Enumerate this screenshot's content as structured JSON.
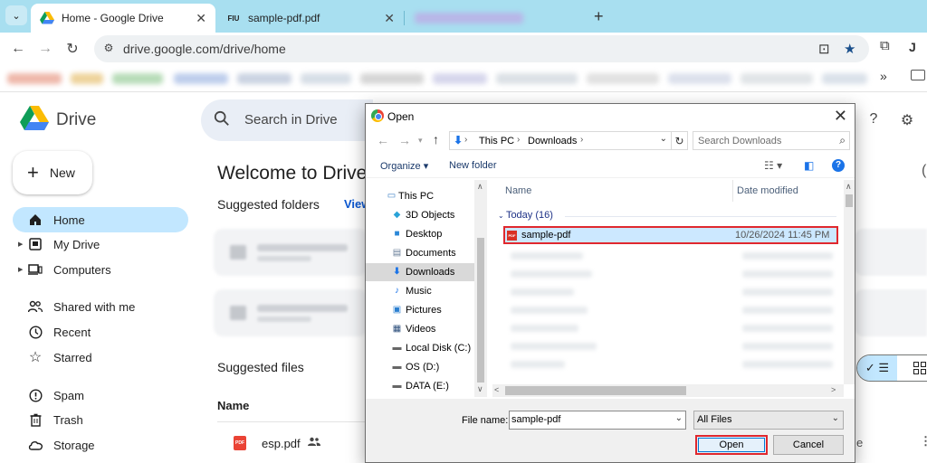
{
  "browser": {
    "tabs": [
      {
        "title": "Home - Google Drive",
        "favicon": "drive-icon",
        "active": true
      },
      {
        "title": "sample-pdf.pdf",
        "favicon": "pdf-site-icon",
        "favicon_text": "FIU",
        "active": false
      },
      {
        "title": "",
        "favicon": "blurred-icon",
        "active": false
      }
    ],
    "url": "drive.google.com/drive/home"
  },
  "drive": {
    "app_name": "Drive",
    "search_placeholder": "Search in Drive",
    "new_label": "New",
    "nav": [
      {
        "label": "Home",
        "icon": "home-icon",
        "active": true
      },
      {
        "label": "My Drive",
        "icon": "my-drive-icon"
      },
      {
        "label": "Computers",
        "icon": "computers-icon"
      },
      {
        "label": "Shared with me",
        "icon": "shared-icon"
      },
      {
        "label": "Recent",
        "icon": "clock-icon"
      },
      {
        "label": "Starred",
        "icon": "star-icon"
      },
      {
        "label": "Spam",
        "icon": "spam-icon"
      },
      {
        "label": "Trash",
        "icon": "trash-icon"
      },
      {
        "label": "Storage",
        "icon": "cloud-icon"
      }
    ],
    "welcome": "Welcome to Drive",
    "suggested_folders": "Suggested folders",
    "view_link": "View",
    "suggested_files": "Suggested files",
    "name_header": "Name",
    "files": [
      {
        "name": "esp.pdf",
        "type": "pdf",
        "shared": true
      }
    ]
  },
  "dialog": {
    "title": "Open",
    "path": [
      "This PC",
      "Downloads"
    ],
    "search_placeholder": "Search Downloads",
    "organize": "Organize ▾",
    "new_folder": "New folder",
    "tree": [
      {
        "label": "This PC",
        "icon": "pc-icon"
      },
      {
        "label": "3D Objects",
        "icon": "3d-objects-icon"
      },
      {
        "label": "Desktop",
        "icon": "desktop-icon"
      },
      {
        "label": "Documents",
        "icon": "documents-icon"
      },
      {
        "label": "Downloads",
        "icon": "downloads-icon",
        "selected": true
      },
      {
        "label": "Music",
        "icon": "music-icon"
      },
      {
        "label": "Pictures",
        "icon": "pictures-icon"
      },
      {
        "label": "Videos",
        "icon": "videos-icon"
      },
      {
        "label": "Local Disk (C:)",
        "icon": "disk-icon"
      },
      {
        "label": "OS (D:)",
        "icon": "drive-icon"
      },
      {
        "label": "DATA (E:)",
        "icon": "drive-icon"
      }
    ],
    "columns": {
      "name": "Name",
      "date": "Date modified"
    },
    "group": "Today (16)",
    "selected_file": {
      "name": "sample-pdf",
      "date": "10/26/2024 11:45 PM"
    },
    "file_name_label": "File name:",
    "file_name_value": "sample-pdf",
    "file_type": "All Files",
    "open_label": "Open",
    "cancel_label": "Cancel"
  },
  "colors": {
    "tabstrip": "#a8dff0",
    "nav_active": "#c2e7ff",
    "highlight_red": "#e0282e",
    "file_selected": "#cce8ff"
  }
}
